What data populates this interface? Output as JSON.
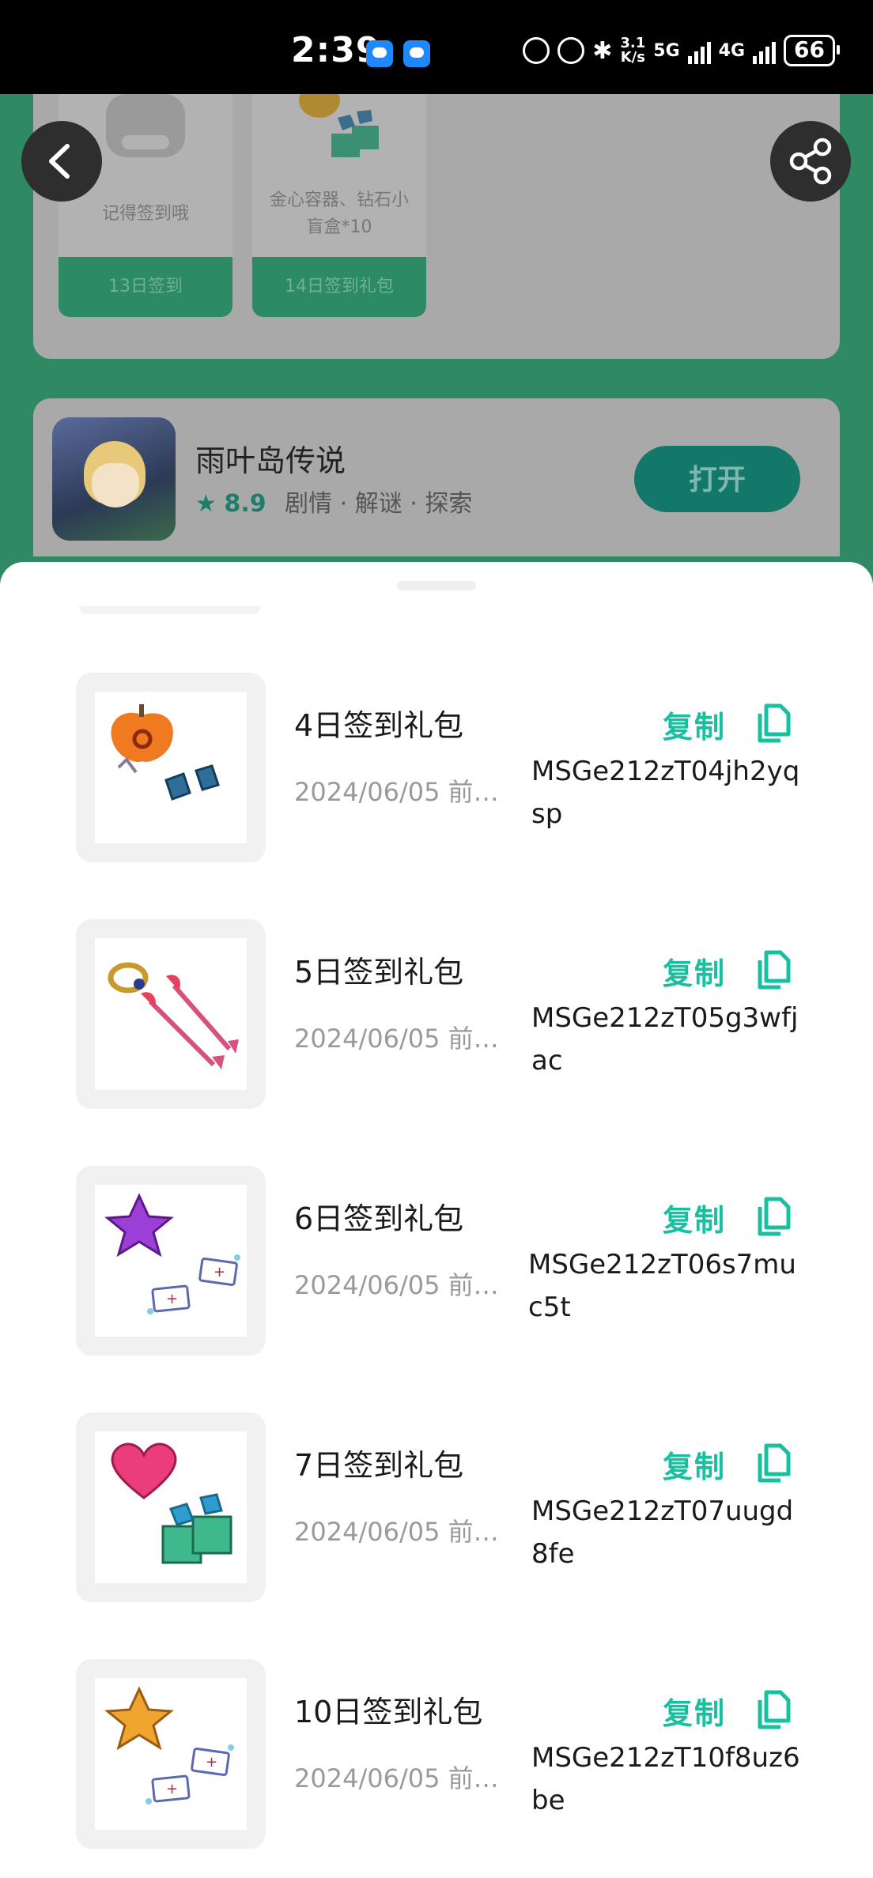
{
  "status_bar": {
    "time": "2:39",
    "speed_top": "3.1",
    "speed_bottom": "K/s",
    "net1": "5G",
    "net2": "4G",
    "battery": "66"
  },
  "background_page": {
    "gift_cards": [
      {
        "label": "记得签到哦",
        "footer": "13日签到"
      },
      {
        "label": "金心容器、钻石小盲盒*10",
        "footer": "14日签到礼包"
      }
    ],
    "app": {
      "name": "雨叶岛传说",
      "rating": "8.9",
      "tags": "剧情 · 解谜 · 探索",
      "open_label": "打开"
    }
  },
  "gift_list": [
    {
      "name": "4日签到礼包",
      "date": "2024/06/05 前…",
      "copy_label": "复制",
      "code": "MSGe212zT04jh2yqsp",
      "thumb_icon": "apple-heart-and-diamond-icon"
    },
    {
      "name": "5日签到礼包",
      "date": "2024/06/05 前…",
      "copy_label": "复制",
      "code": "MSGe212zT05g3wfjac",
      "thumb_icon": "ring-and-arrows-icon"
    },
    {
      "name": "6日签到礼包",
      "date": "2024/06/05 前…",
      "copy_label": "复制",
      "code": "MSGe212zT06s7muc5t",
      "thumb_icon": "purple-star-and-tickets-icon"
    },
    {
      "name": "7日签到礼包",
      "date": "2024/06/05 前…",
      "copy_label": "复制",
      "code": "MSGe212zT07uugd8fe",
      "thumb_icon": "heart-and-gift-boxes-icon"
    },
    {
      "name": "10日签到礼包",
      "date": "2024/06/05 前…",
      "copy_label": "复制",
      "code": "MSGe212zT10f8uz6be",
      "thumb_icon": "gold-star-and-tickets-icon"
    }
  ],
  "colors": {
    "accent": "#17c0a0",
    "sheet_bg": "#ffffff",
    "page_green": "#2f8a63"
  }
}
